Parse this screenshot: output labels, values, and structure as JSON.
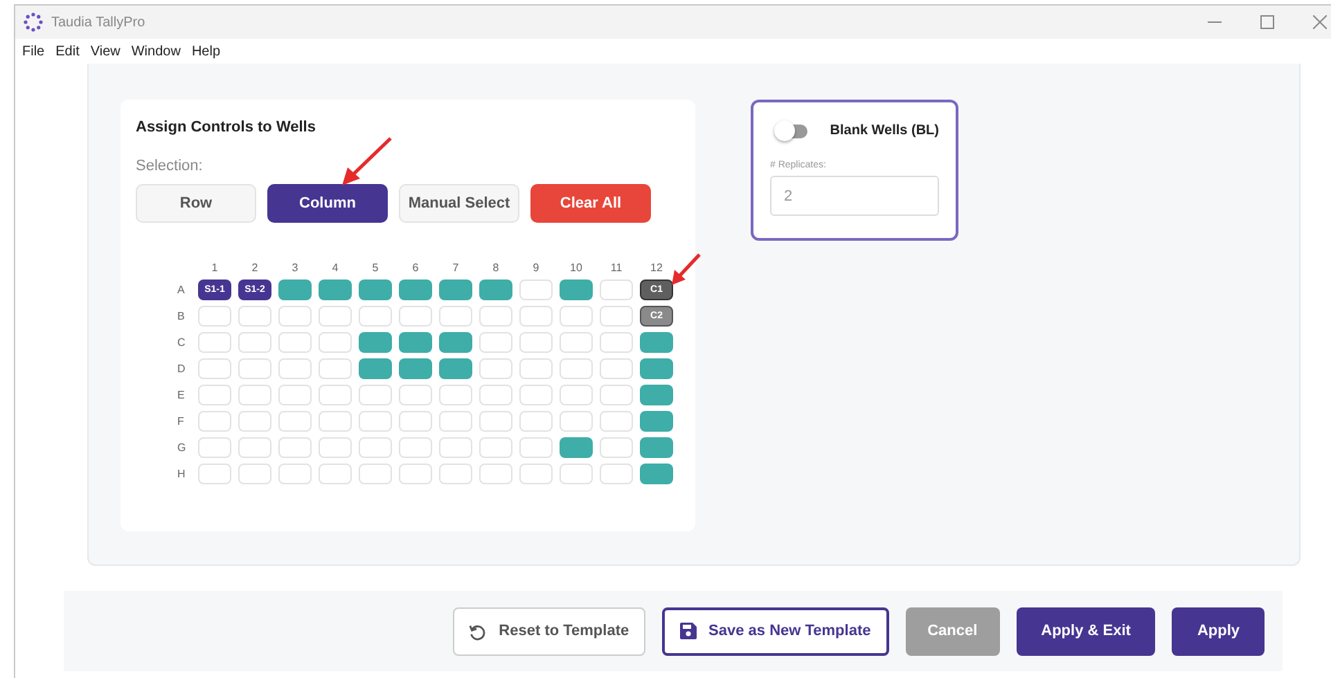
{
  "window": {
    "title": "Taudia TallyPro"
  },
  "menu": [
    "File",
    "Edit",
    "View",
    "Window",
    "Help"
  ],
  "assign_panel": {
    "title": "Assign Controls to Wells",
    "selection_label": "Selection:",
    "selection_buttons": [
      {
        "label": "Row",
        "kind": "mode",
        "selected": false
      },
      {
        "label": "Column",
        "kind": "mode",
        "selected": true
      },
      {
        "label": "Manual Select",
        "kind": "mode",
        "selected": false
      },
      {
        "label": "Clear All",
        "kind": "danger"
      }
    ],
    "columns": [
      "1",
      "2",
      "3",
      "4",
      "5",
      "6",
      "7",
      "8",
      "9",
      "10",
      "11",
      "12"
    ],
    "rows": [
      {
        "label": "A",
        "wells": [
          {
            "kind": "sample",
            "label": "S1-1"
          },
          {
            "kind": "sample",
            "label": "S1-2"
          },
          {
            "kind": "filled"
          },
          {
            "kind": "filled"
          },
          {
            "kind": "filled"
          },
          {
            "kind": "filled"
          },
          {
            "kind": "filled"
          },
          {
            "kind": "filled"
          },
          {
            "kind": "empty"
          },
          {
            "kind": "filled"
          },
          {
            "kind": "empty"
          },
          {
            "kind": "control",
            "label": "C1"
          }
        ]
      },
      {
        "label": "B",
        "wells": [
          {
            "kind": "empty"
          },
          {
            "kind": "empty"
          },
          {
            "kind": "empty"
          },
          {
            "kind": "empty"
          },
          {
            "kind": "empty"
          },
          {
            "kind": "empty"
          },
          {
            "kind": "empty"
          },
          {
            "kind": "empty"
          },
          {
            "kind": "empty"
          },
          {
            "kind": "empty"
          },
          {
            "kind": "empty"
          },
          {
            "kind": "control2",
            "label": "C2"
          }
        ]
      },
      {
        "label": "C",
        "wells": [
          {
            "kind": "empty"
          },
          {
            "kind": "empty"
          },
          {
            "kind": "empty"
          },
          {
            "kind": "empty"
          },
          {
            "kind": "filled"
          },
          {
            "kind": "filled"
          },
          {
            "kind": "filled"
          },
          {
            "kind": "empty"
          },
          {
            "kind": "empty"
          },
          {
            "kind": "empty"
          },
          {
            "kind": "empty"
          },
          {
            "kind": "filled"
          }
        ]
      },
      {
        "label": "D",
        "wells": [
          {
            "kind": "empty"
          },
          {
            "kind": "empty"
          },
          {
            "kind": "empty"
          },
          {
            "kind": "empty"
          },
          {
            "kind": "filled"
          },
          {
            "kind": "filled"
          },
          {
            "kind": "filled"
          },
          {
            "kind": "empty"
          },
          {
            "kind": "empty"
          },
          {
            "kind": "empty"
          },
          {
            "kind": "empty"
          },
          {
            "kind": "filled"
          }
        ]
      },
      {
        "label": "E",
        "wells": [
          {
            "kind": "empty"
          },
          {
            "kind": "empty"
          },
          {
            "kind": "empty"
          },
          {
            "kind": "empty"
          },
          {
            "kind": "empty"
          },
          {
            "kind": "empty"
          },
          {
            "kind": "empty"
          },
          {
            "kind": "empty"
          },
          {
            "kind": "empty"
          },
          {
            "kind": "empty"
          },
          {
            "kind": "empty"
          },
          {
            "kind": "filled"
          }
        ]
      },
      {
        "label": "F",
        "wells": [
          {
            "kind": "empty"
          },
          {
            "kind": "empty"
          },
          {
            "kind": "empty"
          },
          {
            "kind": "empty"
          },
          {
            "kind": "empty"
          },
          {
            "kind": "empty"
          },
          {
            "kind": "empty"
          },
          {
            "kind": "empty"
          },
          {
            "kind": "empty"
          },
          {
            "kind": "empty"
          },
          {
            "kind": "empty"
          },
          {
            "kind": "filled"
          }
        ]
      },
      {
        "label": "G",
        "wells": [
          {
            "kind": "empty"
          },
          {
            "kind": "empty"
          },
          {
            "kind": "empty"
          },
          {
            "kind": "empty"
          },
          {
            "kind": "empty"
          },
          {
            "kind": "empty"
          },
          {
            "kind": "empty"
          },
          {
            "kind": "empty"
          },
          {
            "kind": "empty"
          },
          {
            "kind": "filled"
          },
          {
            "kind": "empty"
          },
          {
            "kind": "filled"
          }
        ]
      },
      {
        "label": "H",
        "wells": [
          {
            "kind": "empty"
          },
          {
            "kind": "empty"
          },
          {
            "kind": "empty"
          },
          {
            "kind": "empty"
          },
          {
            "kind": "empty"
          },
          {
            "kind": "empty"
          },
          {
            "kind": "empty"
          },
          {
            "kind": "empty"
          },
          {
            "kind": "empty"
          },
          {
            "kind": "empty"
          },
          {
            "kind": "empty"
          },
          {
            "kind": "filled"
          }
        ]
      }
    ]
  },
  "blank_wells": {
    "label": "Blank Wells (BL)",
    "on": false,
    "replicates_label": "# Replicates:",
    "replicates_value": "2"
  },
  "footer_buttons": [
    {
      "label": "Reset to Template",
      "kind": "reset"
    },
    {
      "label": "Save as New Template",
      "kind": "save"
    },
    {
      "label": "Cancel",
      "kind": "muted"
    },
    {
      "label": "Apply & Exit",
      "kind": "primary"
    },
    {
      "label": "Apply",
      "kind": "primary"
    }
  ]
}
